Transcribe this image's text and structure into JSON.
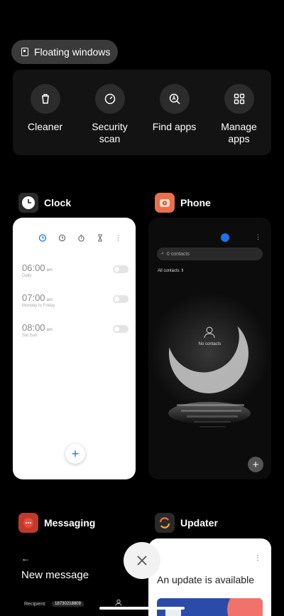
{
  "floating_windows": {
    "label": "Floating windows"
  },
  "quick_actions": [
    {
      "label": "Cleaner",
      "icon": "trash-icon"
    },
    {
      "label": "Security\nscan",
      "icon": "security-icon"
    },
    {
      "label": "Find apps",
      "icon": "find-apps-icon"
    },
    {
      "label": "Manage\napps",
      "icon": "grid-icon"
    }
  ],
  "apps": {
    "clock": {
      "name": "Clock",
      "icon": "clock-icon"
    },
    "phone": {
      "name": "Phone",
      "icon": "phone-icon"
    },
    "messaging": {
      "name": "Messaging",
      "icon": "messaging-icon"
    },
    "updater": {
      "name": "Updater",
      "icon": "updater-icon"
    }
  },
  "clock_preview": {
    "alarms": [
      {
        "time": "06:00",
        "ampm": "am",
        "repeat": "Daily"
      },
      {
        "time": "07:00",
        "ampm": "am",
        "repeat": "Monday to Friday"
      },
      {
        "time": "08:00",
        "ampm": "am",
        "repeat": "Sat Sun"
      }
    ],
    "add_label": "+"
  },
  "phone_preview": {
    "search_placeholder": "0 contacts",
    "filter_label": "All contacts",
    "empty_label": "No contacts",
    "add_label": "+"
  },
  "messaging_preview": {
    "back": "←",
    "title": "New message",
    "recipient_label": "Recipient:",
    "recipient_value": "18730218809"
  },
  "updater_preview": {
    "message": "An update is available",
    "menu": "⋮"
  },
  "colors": {
    "accent": "#1a73e8",
    "background": "#000000"
  }
}
